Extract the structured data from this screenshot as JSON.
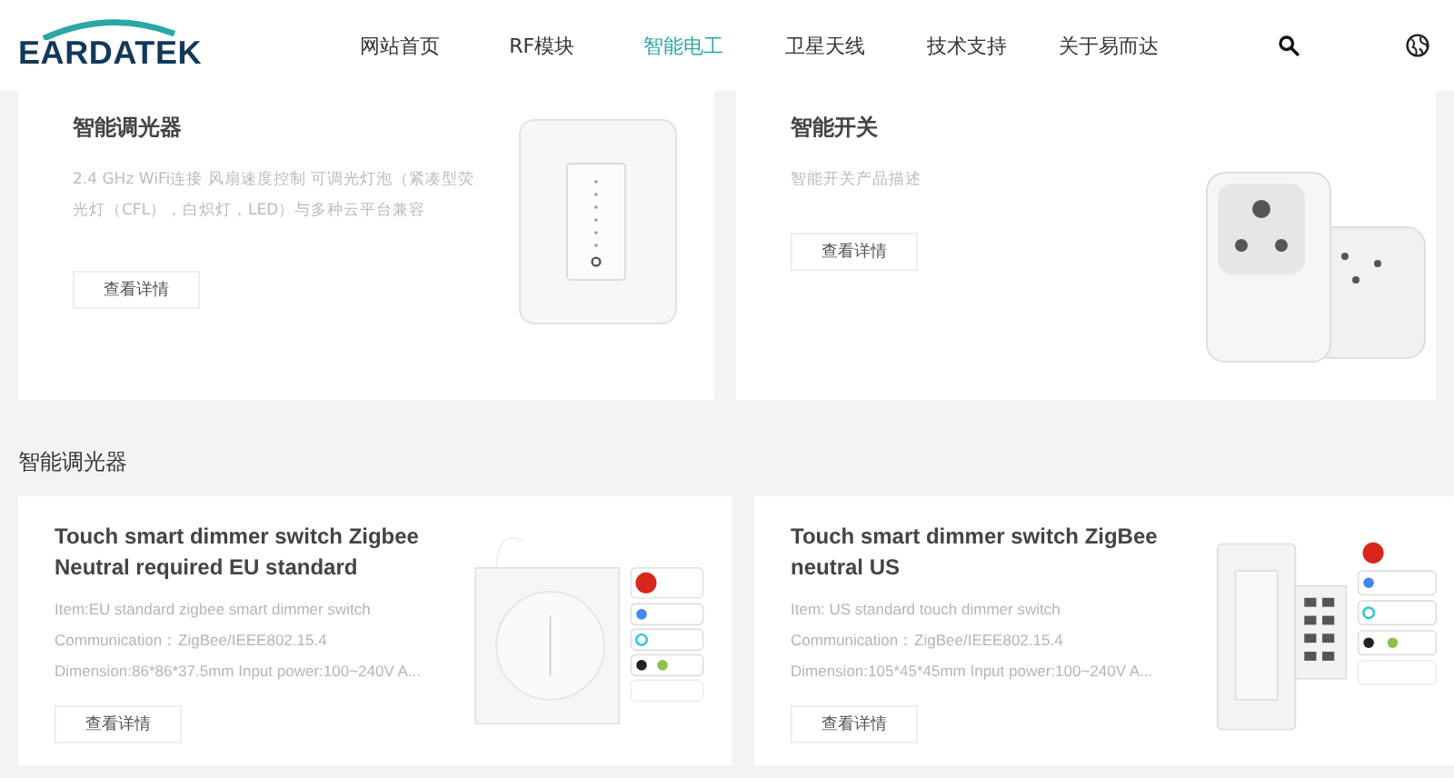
{
  "header": {
    "logo": "EARDATEK",
    "nav": [
      {
        "label": "网站首页",
        "selected": false
      },
      {
        "label": "RF模块",
        "selected": false
      },
      {
        "label": "智能电工",
        "selected": true
      },
      {
        "label": "卫星天线",
        "selected": false
      },
      {
        "label": "技术支持",
        "selected": false
      },
      {
        "label": "关于易而达",
        "selected": false
      }
    ]
  },
  "top_cards": [
    {
      "title": "智能调光器",
      "description": "2.4 GHz WiFi连接 风扇速度控制 可调光灯泡（紧凑型荧光灯（CFL），白炽灯，LED）与多种云平台兼容",
      "button": "查看详情",
      "kind": "dimmer"
    },
    {
      "title": "智能开关",
      "description": "智能开关产品描述",
      "button": "查看详情",
      "kind": "plug"
    }
  ],
  "section": {
    "title": "智能调光器",
    "cards": [
      {
        "title": "Touch smart dimmer switch Zigbee Neutral required EU standard",
        "specs": [
          "Item:EU standard zigbee smart dimmer switch",
          "Communication：ZigBee/IEEE802.15.4",
          "Dimension:86*86*37.5mm Input power:100~240V A..."
        ],
        "button": "查看详情",
        "kind": "eu"
      },
      {
        "title": "Touch smart dimmer switch ZigBee neutral US",
        "specs": [
          "Item: US standard touch dimmer switch",
          "Communication：ZigBee/IEEE802.15.4",
          "Dimension:105*45*45mm Input power:100~240V A..."
        ],
        "button": "查看详情",
        "kind": "us"
      }
    ]
  }
}
